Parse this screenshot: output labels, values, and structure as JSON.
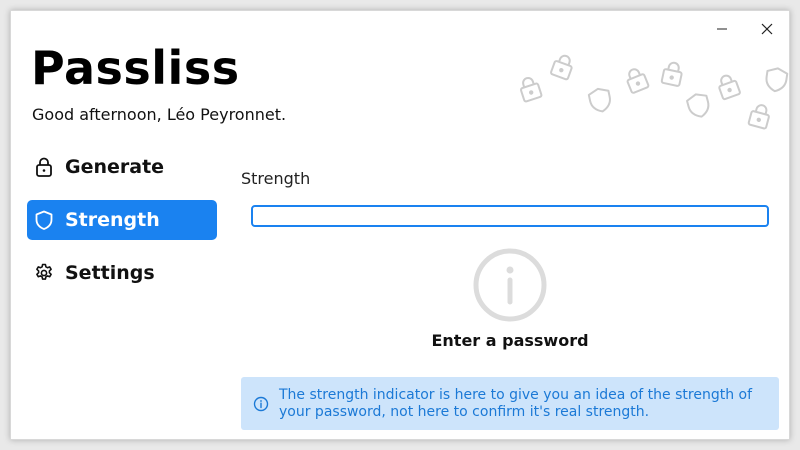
{
  "app": {
    "title": "Passliss",
    "greeting": "Good afternoon, Léo Peyronnet."
  },
  "nav": {
    "items": [
      {
        "label": "Generate",
        "icon": "lock-icon",
        "active": false
      },
      {
        "label": "Strength",
        "icon": "shield-icon",
        "active": true
      },
      {
        "label": "Settings",
        "icon": "gear-icon",
        "active": false
      }
    ]
  },
  "strength": {
    "label": "Strength",
    "input_value": "",
    "status": "Enter a password",
    "info": "The strength indicator is here to give you an idea of the strength of your password, not here to confirm it's real strength."
  },
  "window_controls": {
    "minimize": "minimize-icon",
    "close": "close-icon"
  },
  "colors": {
    "accent": "#1a82f0",
    "info_background": "#cde4fb",
    "info_text": "#1b79d6",
    "decor_icons": "#cccccc"
  }
}
